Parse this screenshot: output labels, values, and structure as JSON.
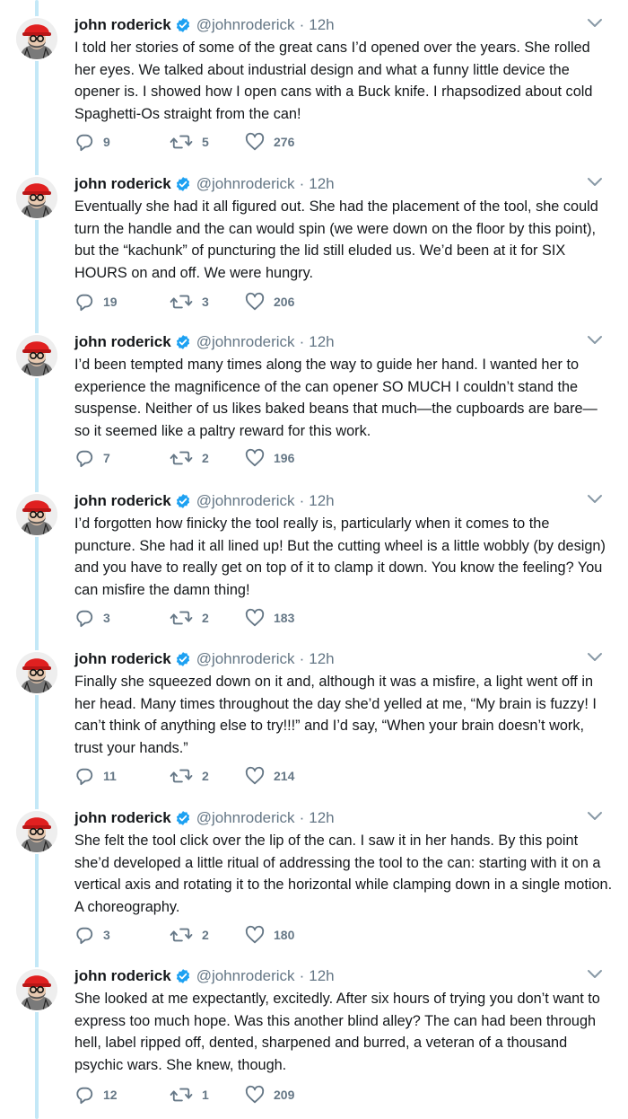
{
  "colors": {
    "accent": "#1da1f2",
    "thread_line": "#c4e8f7",
    "muted": "#657786",
    "text": "#14171a"
  },
  "author": {
    "name": "john roderick",
    "handle": "@johnroderick",
    "time": "12h",
    "separator": "·"
  },
  "icons": {
    "verified": "verified-badge-icon",
    "caret": "chevron-down-icon",
    "reply": "reply-icon",
    "retweet": "retweet-icon",
    "like": "heart-icon"
  },
  "tweets": [
    {
      "text": "I told her stories of some of the great cans I’d opened over the years. She rolled her eyes. We talked about industrial design and what a funny little device the opener is. I showed how I open cans with a Buck knife. I rhapsodized about cold Spaghetti-Os straight from the can!",
      "replies": "9",
      "retweets": "5",
      "likes": "276"
    },
    {
      "text": "Eventually she had it all figured out. She had the placement of the tool, she could turn the handle and the can would spin (we were down on the floor by this point), but the “kachunk” of puncturing the lid still eluded us. We’d been at it for SIX HOURS on and off. We were hungry.",
      "replies": "19",
      "retweets": "3",
      "likes": "206"
    },
    {
      "text": "I’d been tempted many times along the way to guide her hand. I wanted her to experience the magnificence of the can opener SO MUCH I couldn’t stand the suspense. Neither of us likes baked beans that much—the cupboards are bare—so it seemed like a paltry reward for this work.",
      "replies": "7",
      "retweets": "2",
      "likes": "196"
    },
    {
      "text": "I’d forgotten how finicky the tool really is, particularly when it comes to the puncture. She had it all lined up! But the cutting wheel is a little wobbly (by design) and you have to really get on top of it to clamp it down. You know the feeling? You can misfire the damn thing!",
      "replies": "3",
      "retweets": "2",
      "likes": "183"
    },
    {
      "text": "Finally she squeezed down on it and, although it was a misfire, a light went off in her head. Many times throughout the day she’d yelled at me, “My brain is fuzzy! I can’t think of anything else to try!!!” and I’d say, “When your brain doesn’t work, trust your hands.”",
      "replies": "11",
      "retweets": "2",
      "likes": "214"
    },
    {
      "text": "She felt the tool click over the lip of the can. I saw it in her hands. By this point she’d developed a little ritual of addressing the tool to the can: starting with it on a vertical axis and rotating it to the horizontal while clamping down in a single motion. A choreography.",
      "replies": "3",
      "retweets": "2",
      "likes": "180"
    },
    {
      "text": "She looked at me expectantly, excitedly. After six hours of trying you don’t want to express too much hope. Was this another blind alley? The can had been through hell, label ripped off, dented, sharpened and burred, a veteran of a thousand psychic wars. She knew, though.",
      "replies": "12",
      "retweets": "1",
      "likes": "209"
    }
  ]
}
